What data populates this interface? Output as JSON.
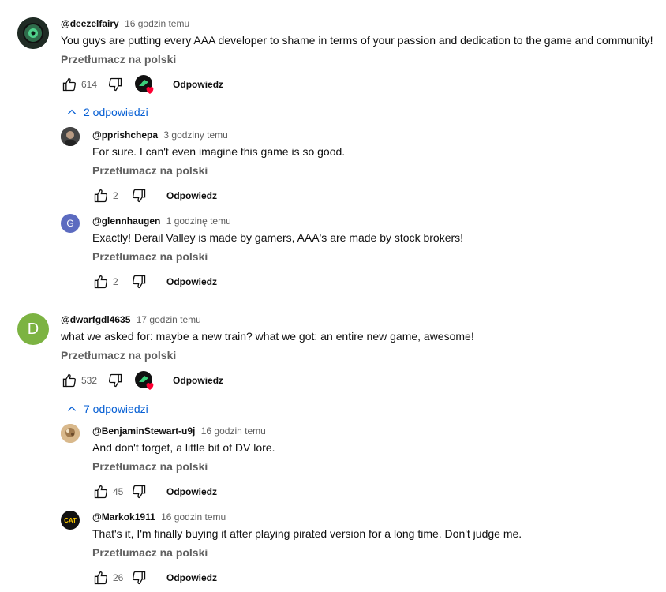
{
  "translate_label": "Przetłumacz na polski",
  "reply_label": "Odpowiedz",
  "comments": [
    {
      "author": "@deezelfairy",
      "time": "16 godzin temu",
      "text": "You guys are putting every AAA developer to shame in terms of your passion and dedication to the game and community!",
      "likes": "614",
      "replies_toggle": "2 odpowiedzi",
      "replies": [
        {
          "author": "@pprishchepa",
          "time": "3 godziny temu",
          "text": "For sure. I can't even imagine this game is so good.",
          "likes": "2"
        },
        {
          "author": "@glennhaugen",
          "time": "1 godzinę temu",
          "text": "Exactly! Derail Valley is made by gamers, AAA's are made by stock brokers!",
          "likes": "2",
          "avatar_letter": "G"
        }
      ]
    },
    {
      "author": "@dwarfgdl4635",
      "time": "17 godzin temu",
      "text": "what we asked for: maybe a new train? what we got: an entire new game, awesome!",
      "likes": "532",
      "avatar_letter": "D",
      "replies_toggle": "7 odpowiedzi",
      "replies": [
        {
          "author": "@BenjaminStewart-u9j",
          "time": "16 godzin temu",
          "text": "And don't forget, a little bit of DV lore.",
          "likes": "45"
        },
        {
          "author": "@Markok1911",
          "time": "16 godzin temu",
          "text": "That's it, I'm finally buying it after playing pirated version for a long time. Don't judge me.",
          "likes": "26",
          "avatar_letter": "CAT"
        }
      ]
    }
  ],
  "colors": {
    "link": "#065fd4",
    "muted": "#606060",
    "heart": "#ff0033",
    "avatar_g": "#5c6bc0",
    "avatar_d": "#7cb342"
  }
}
